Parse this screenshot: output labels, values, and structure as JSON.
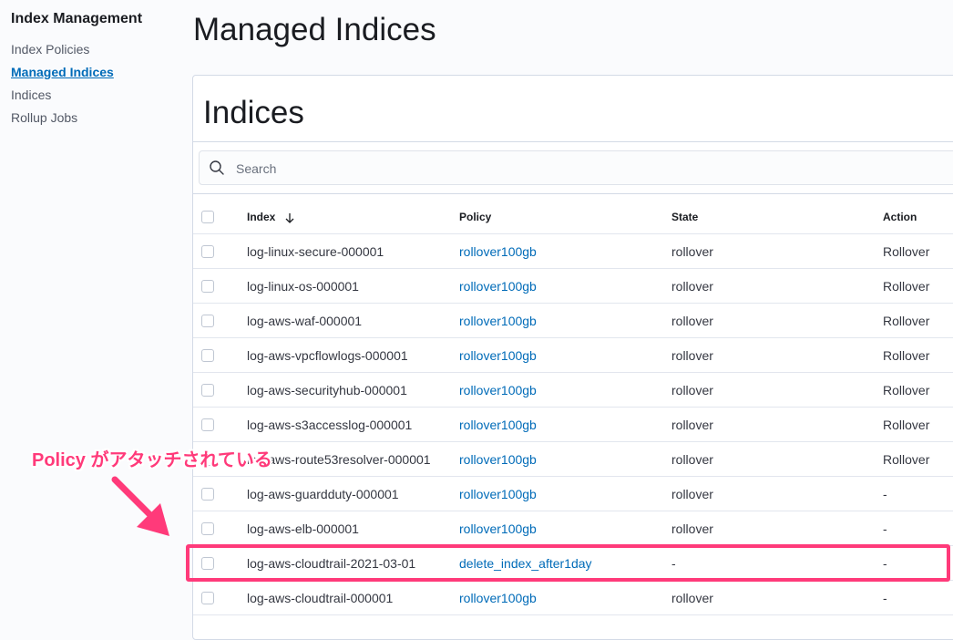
{
  "sidebar": {
    "title": "Index Management",
    "items": [
      {
        "label": "Index Policies",
        "active": false
      },
      {
        "label": "Managed Indices",
        "active": true
      },
      {
        "label": "Indices",
        "active": false
      },
      {
        "label": "Rollup Jobs",
        "active": false
      }
    ]
  },
  "page": {
    "title": "Managed Indices"
  },
  "panel": {
    "title": "Indices",
    "search": {
      "placeholder": "Search",
      "value": ""
    }
  },
  "table": {
    "columns": {
      "index": "Index",
      "policy": "Policy",
      "state": "State",
      "action": "Action"
    },
    "rows": [
      {
        "index": "log-linux-secure-000001",
        "policy": "rollover100gb",
        "state": "rollover",
        "action": "Rollover"
      },
      {
        "index": "log-linux-os-000001",
        "policy": "rollover100gb",
        "state": "rollover",
        "action": "Rollover"
      },
      {
        "index": "log-aws-waf-000001",
        "policy": "rollover100gb",
        "state": "rollover",
        "action": "Rollover"
      },
      {
        "index": "log-aws-vpcflowlogs-000001",
        "policy": "rollover100gb",
        "state": "rollover",
        "action": "Rollover"
      },
      {
        "index": "log-aws-securityhub-000001",
        "policy": "rollover100gb",
        "state": "rollover",
        "action": "Rollover"
      },
      {
        "index": "log-aws-s3accesslog-000001",
        "policy": "rollover100gb",
        "state": "rollover",
        "action": "Rollover"
      },
      {
        "index": "log-aws-route53resolver-000001",
        "policy": "rollover100gb",
        "state": "rollover",
        "action": "Rollover"
      },
      {
        "index": "log-aws-guardduty-000001",
        "policy": "rollover100gb",
        "state": "rollover",
        "action": "-"
      },
      {
        "index": "log-aws-elb-000001",
        "policy": "rollover100gb",
        "state": "rollover",
        "action": "-"
      },
      {
        "index": "log-aws-cloudtrail-2021-03-01",
        "policy": "delete_index_after1day",
        "state": "-",
        "action": "-"
      },
      {
        "index": "log-aws-cloudtrail-000001",
        "policy": "rollover100gb",
        "state": "rollover",
        "action": "-"
      }
    ]
  },
  "annotation": {
    "label": "Policy がアタッチされている",
    "color": "#ff3a7a"
  },
  "colors": {
    "link": "#006bb8",
    "accent": "#ff3a7a"
  }
}
